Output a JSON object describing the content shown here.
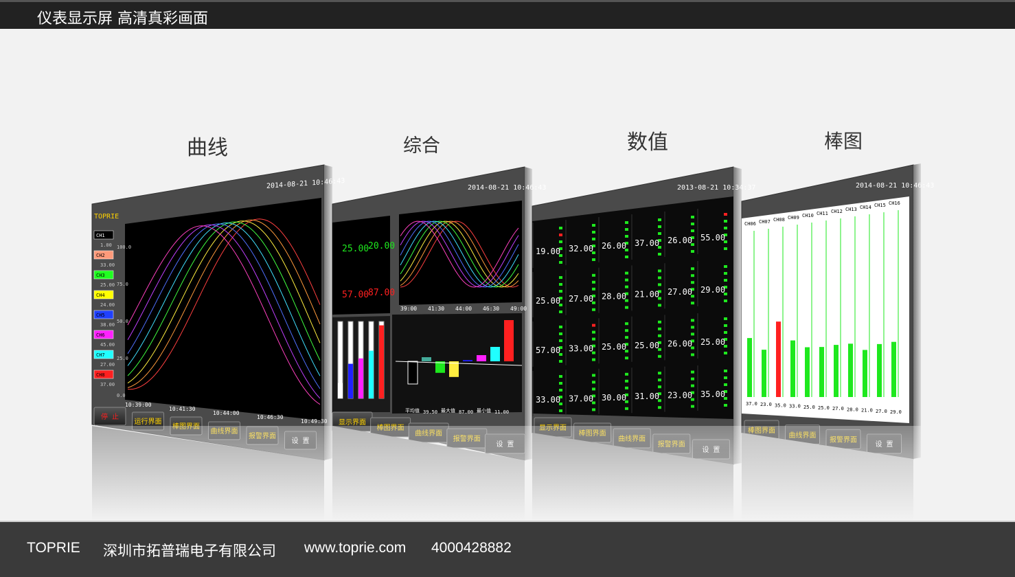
{
  "header": {
    "title": "仪表显示屏 高清真彩画面"
  },
  "panels": [
    {
      "title": "曲线",
      "datetime": "2014-08-21  10:46:43",
      "brand": "TOPRIE",
      "axis": [
        "100.0",
        "75.0",
        "50.0",
        "25.0",
        "0.0"
      ],
      "times": [
        "10:39:00",
        "10:41:30",
        "10:44:00",
        "10:46:30",
        "10:49:30"
      ],
      "channels": [
        "CH1",
        "CH2",
        "CH3",
        "CH4",
        "CH5",
        "CH6",
        "CH7",
        "CH8"
      ],
      "channel_values": [
        "1.00",
        "33.00",
        "25.00",
        "24.00",
        "38.00",
        "45.00",
        "27.00",
        "37.00"
      ],
      "buttons": [
        "停 止",
        "运行界面",
        "棒图界面",
        "曲线界面",
        "报警界面",
        "设 置"
      ]
    },
    {
      "title": "综合",
      "datetime": "2014-08-21  10:46:43",
      "values": [
        "25.00",
        "20.00",
        "57.00",
        "87.00"
      ],
      "times": [
        "39:00",
        "41:30",
        "44:00",
        "46:30",
        "49:00"
      ],
      "stats": [
        "平均值",
        "39.50",
        "最大值",
        "87.00",
        "最小值",
        "11.00"
      ],
      "buttons": [
        "显示界面",
        "棒图界面",
        "曲线界面",
        "报警界面",
        "设 置"
      ]
    },
    {
      "title": "数值",
      "datetime": "2013-08-21  10:34:37",
      "values": [
        "19.00",
        "32.00",
        "26.00",
        "37.00",
        "26.00",
        "55.00",
        "25.00",
        "27.00",
        "28.00",
        "21.00",
        "27.00",
        "29.00",
        "57.00",
        "33.00",
        "25.00",
        "25.00",
        "26.00",
        "25.00",
        "33.00",
        "37.00",
        "30.00",
        "31.00",
        "23.00",
        "35.00"
      ],
      "buttons": [
        "显示界面",
        "棒图界面",
        "曲线界面",
        "报警界面",
        "设 置"
      ]
    },
    {
      "title": "棒图",
      "datetime": "2014-08-21  10:46:43",
      "channels": [
        "CH06",
        "CH07",
        "CH08",
        "CH09",
        "CH10",
        "CH11",
        "CH12",
        "CH13",
        "CH14",
        "CH15",
        "CH16"
      ],
      "values": [
        "37.0",
        "23.0",
        "35.0",
        "33.0",
        "25.0",
        "25.0",
        "27.0",
        "28.0",
        "21.0",
        "27.0",
        "29.0"
      ],
      "levels": [
        0.37,
        0.23,
        0.55,
        0.33,
        0.25,
        0.25,
        0.27,
        0.28,
        0.21,
        0.27,
        0.29
      ],
      "buttons": [
        "棒图界面",
        "曲线界面",
        "报警界面",
        "设 置"
      ]
    }
  ],
  "footer": {
    "brand": "TOPRIE",
    "company": "深圳市拓普瑞电子有限公司",
    "website": "www.toprie.com",
    "phone": "4000428882"
  },
  "colors": {
    "screen": "#000000",
    "bezel": "#4a4a4a",
    "value": "#1ee81e",
    "alarm": "#ff2020",
    "button_text": "#ffd200"
  }
}
